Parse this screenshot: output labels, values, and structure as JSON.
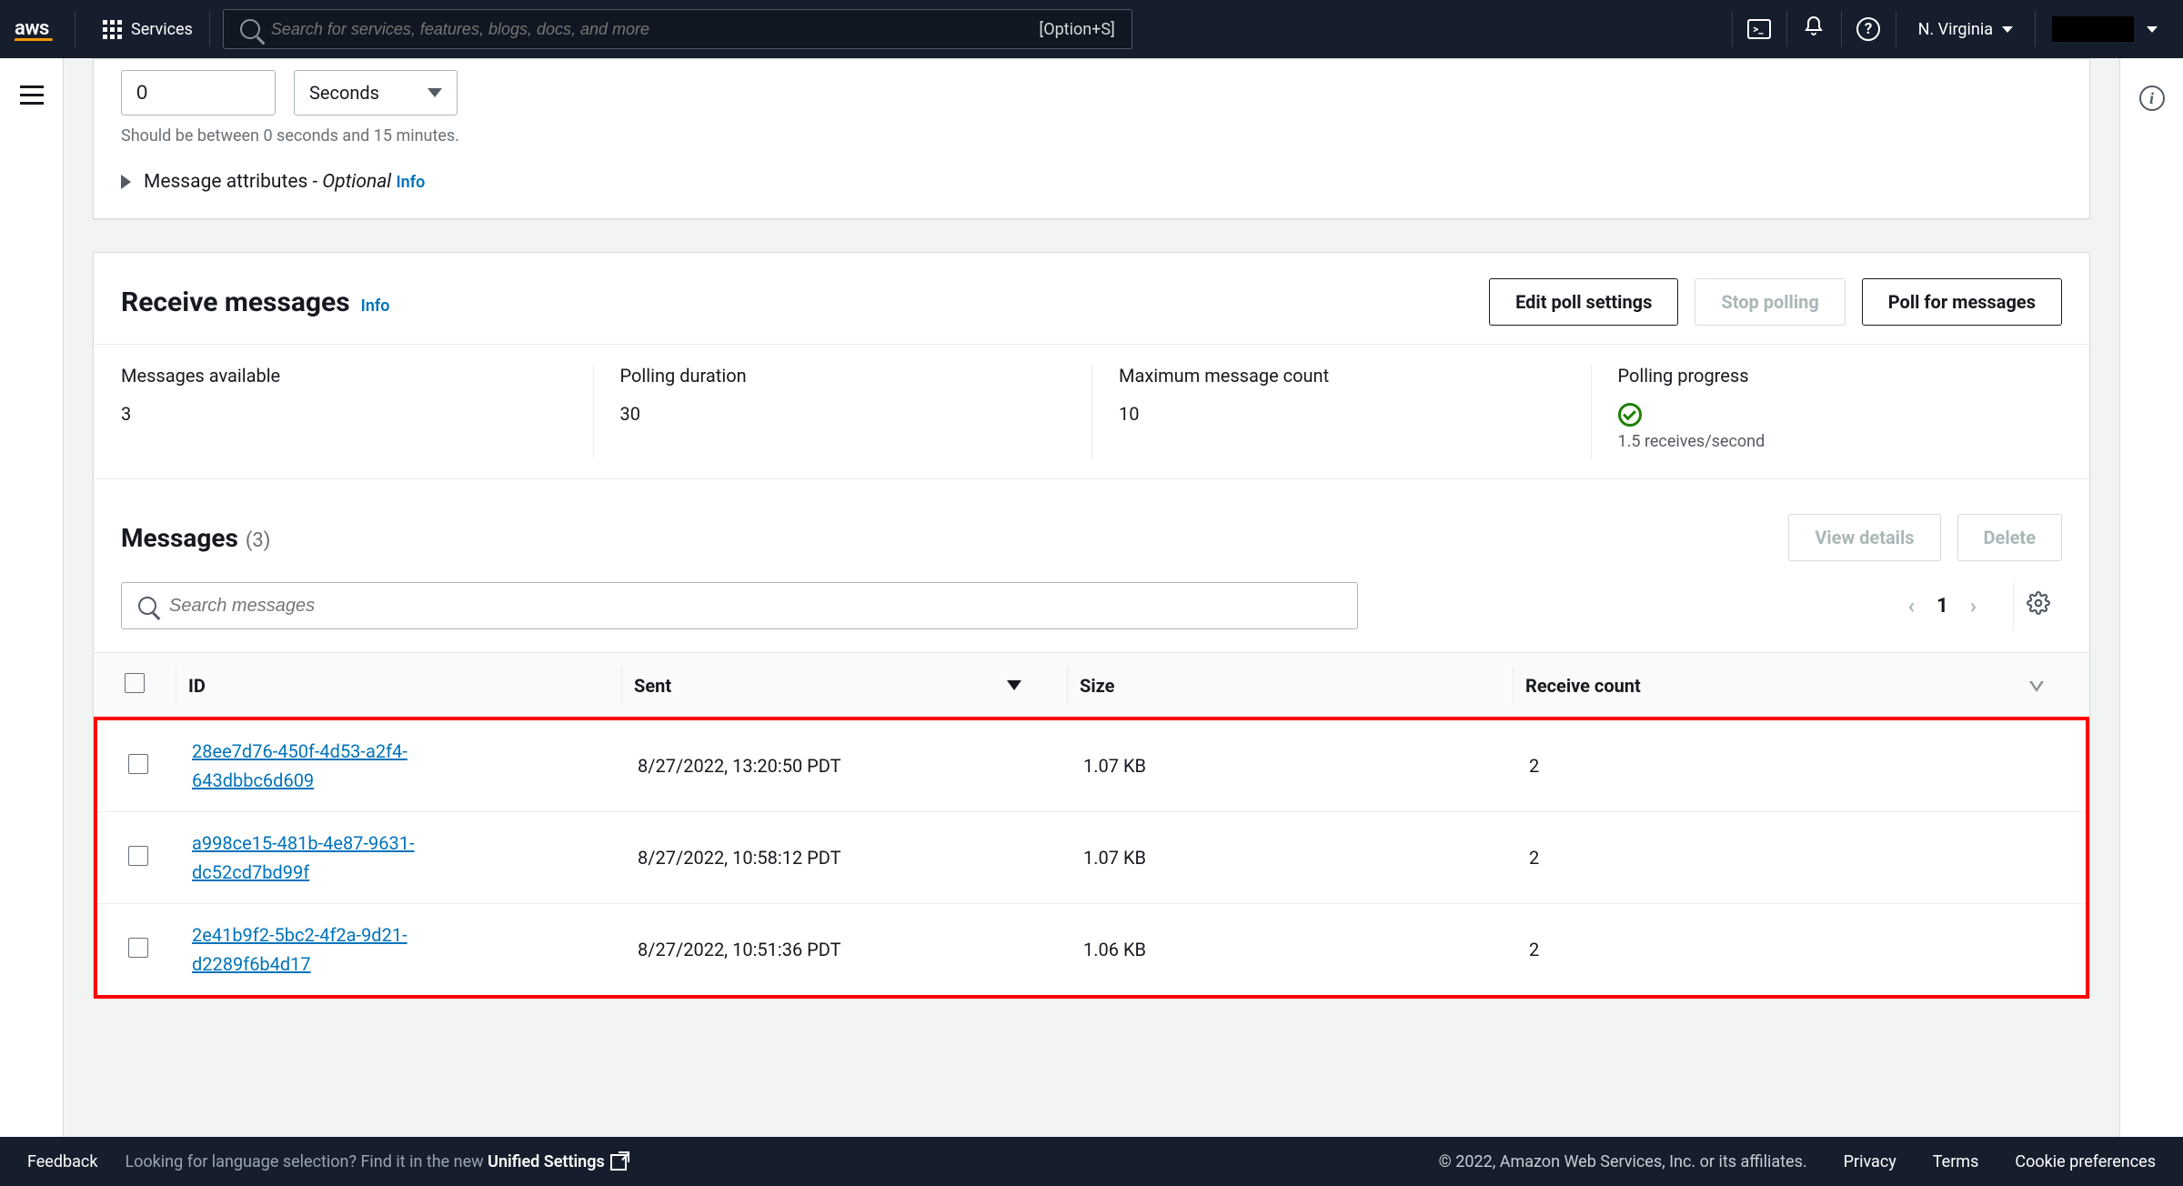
{
  "nav": {
    "logo": "aws",
    "services": "Services",
    "search_placeholder": "Search for services, features, blogs, docs, and more",
    "shortcut": "[Option+S]",
    "region": "N. Virginia"
  },
  "poll_config": {
    "value": "0",
    "unit": "Seconds",
    "hint": "Should be between 0 seconds and 15 minutes.",
    "attributes_label": "Message attributes",
    "optional": " - Optional",
    "info": "Info"
  },
  "receive": {
    "title": "Receive messages",
    "info": "Info",
    "edit_btn": "Edit poll settings",
    "stop_btn": "Stop polling",
    "poll_btn": "Poll for messages",
    "metrics": {
      "available_label": "Messages available",
      "available_value": "3",
      "duration_label": "Polling duration",
      "duration_value": "30",
      "max_label": "Maximum message count",
      "max_value": "10",
      "progress_label": "Polling progress",
      "progress_value": "1.5 receives/second"
    }
  },
  "messages": {
    "title": "Messages",
    "count": "(3)",
    "view_btn": "View details",
    "delete_btn": "Delete",
    "search_placeholder": "Search messages",
    "page": "1",
    "columns": {
      "id": "ID",
      "sent": "Sent",
      "size": "Size",
      "receive": "Receive count"
    },
    "rows": [
      {
        "id": "28ee7d76-450f-4d53-a2f4-643dbbc6d609",
        "sent": "8/27/2022, 13:20:50 PDT",
        "size": "1.07 KB",
        "rc": "2"
      },
      {
        "id": "a998ce15-481b-4e87-9631-dc52cd7bd99f",
        "sent": "8/27/2022, 10:58:12 PDT",
        "size": "1.07 KB",
        "rc": "2"
      },
      {
        "id": "2e41b9f2-5bc2-4f2a-9d21-d2289f6b4d17",
        "sent": "8/27/2022, 10:51:36 PDT",
        "size": "1.06 KB",
        "rc": "2"
      }
    ]
  },
  "footer": {
    "feedback": "Feedback",
    "lang_prefix": "Looking for language selection? Find it in the new ",
    "unified": "Unified Settings",
    "copyright": "© 2022, Amazon Web Services, Inc. or its affiliates.",
    "privacy": "Privacy",
    "terms": "Terms",
    "cookies": "Cookie preferences"
  }
}
